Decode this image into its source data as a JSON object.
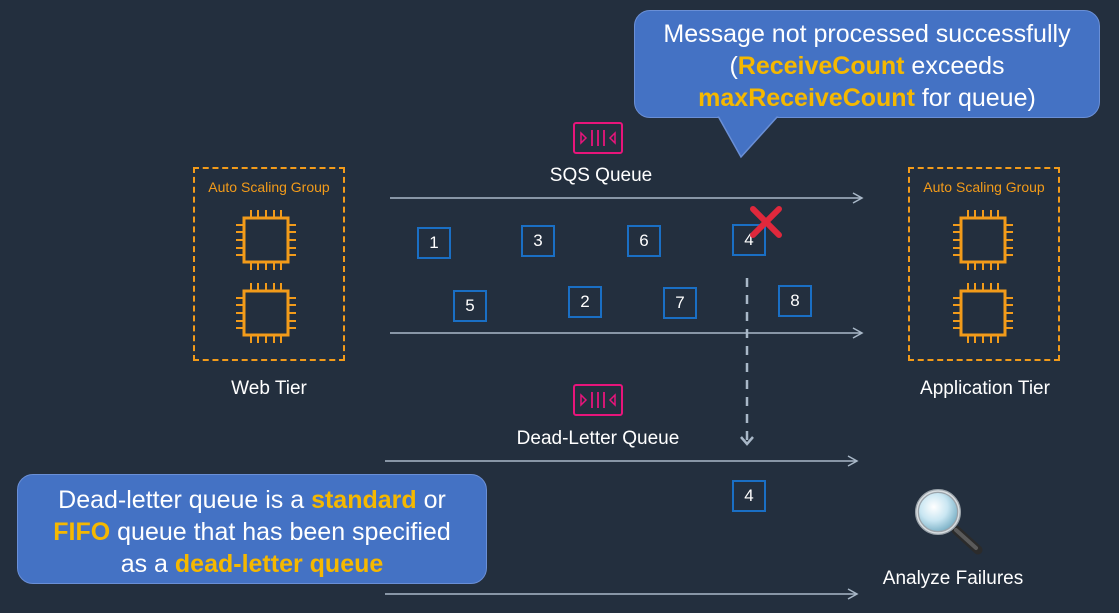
{
  "web_tier": {
    "group_label": "Auto Scaling Group",
    "tier_label": "Web Tier"
  },
  "app_tier": {
    "group_label": "Auto Scaling Group",
    "tier_label": "Application Tier"
  },
  "sqs_queue": {
    "title": "SQS Queue",
    "messages": [
      "1",
      "3",
      "6",
      "4",
      "5",
      "2",
      "7",
      "8"
    ]
  },
  "failed_message": "4",
  "dead_letter_queue": {
    "title": "Dead-Letter Queue",
    "message": "4"
  },
  "analyze": {
    "label": "Analyze Failures"
  },
  "callout_top": {
    "line1": "Message not processed successfully",
    "line2_pre": "(",
    "line2_hl": "ReceiveCount",
    "line2_post": " exceeds",
    "line3_hl": "maxReceiveCount",
    "line3_post": " for queue)"
  },
  "callout_bottom": {
    "line1_pre": "Dead-letter queue is a ",
    "line1_hl": "standard",
    "line1_post": " or",
    "line2_hl": "FIFO",
    "line2_post": " queue that has been specified",
    "line3_pre": "as a ",
    "line3_hl": "dead-letter queue"
  },
  "colors": {
    "background": "#232f3e",
    "accent_orange": "#f29b1a",
    "queue_pink": "#e7157b",
    "message_blue": "#1a6fc4",
    "callout_blue": "#4472c4",
    "highlight_yellow": "#f5b800",
    "error_red": "#e0283c"
  }
}
